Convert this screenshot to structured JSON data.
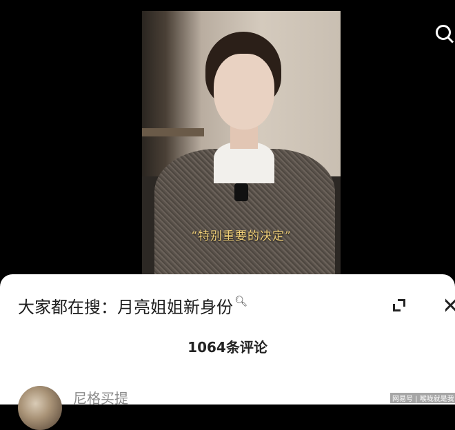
{
  "video": {
    "caption": "“特别重要的决定”"
  },
  "header": {
    "search_icon": "search-icon"
  },
  "sheet": {
    "search_title": "大家都在搜：月亮姐姐新身份",
    "search_title_icon": "search-icon",
    "expand_icon": "expand-icon",
    "close_icon": "close-icon",
    "comment_count": "1064条评论"
  },
  "comments": [
    {
      "username": "尼格买提"
    }
  ],
  "watermark": {
    "text": "网易号 | 喉咙就是我"
  }
}
